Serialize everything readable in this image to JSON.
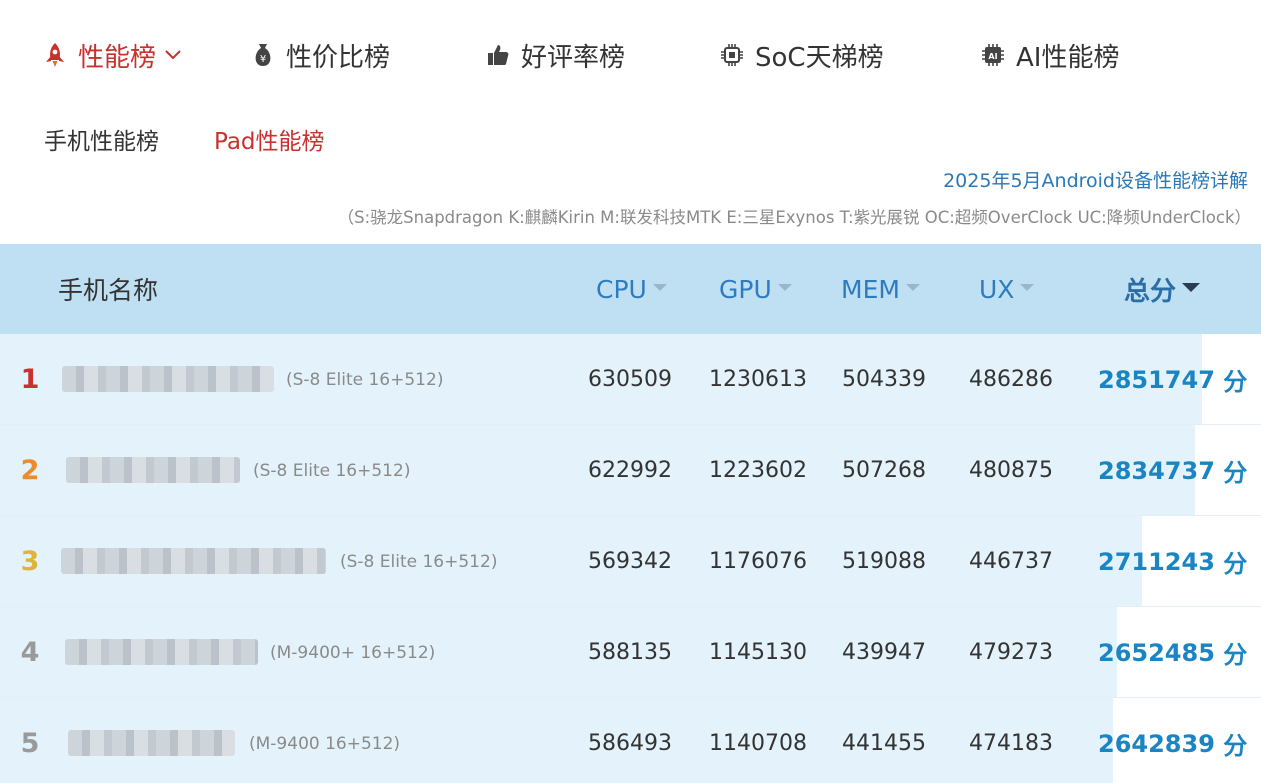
{
  "colors": {
    "accent_red": "#c8312e",
    "link_blue": "#2a78b8",
    "header_bg": "#bfe0f3",
    "row_bar": "#e4f3fb",
    "score_blue": "#1a85c2"
  },
  "nav": {
    "items": [
      {
        "label": "性能榜",
        "icon": "rocket-icon",
        "active": true
      },
      {
        "label": "性价比榜",
        "icon": "money-bag-icon",
        "active": false
      },
      {
        "label": "好评率榜",
        "icon": "thumbs-up-icon",
        "active": false
      },
      {
        "label": "SoC天梯榜",
        "icon": "chip-icon",
        "active": false
      },
      {
        "label": "AI性能榜",
        "icon": "ai-chip-icon",
        "active": false
      }
    ]
  },
  "subnav": {
    "items": [
      {
        "label": "手机性能榜",
        "active": false
      },
      {
        "label": "Pad性能榜",
        "active": true
      }
    ]
  },
  "detail_link": "2025年5月Android设备性能榜详解",
  "legend_note": "（S:骁龙Snapdragon K:麒麟Kirin M:联发科技MTK E:三星Exynos T:紫光展锐 OC:超频OverClock UC:降频UnderClock）",
  "table": {
    "headers": {
      "name": "手机名称",
      "cpu": "CPU",
      "gpu": "GPU",
      "mem": "MEM",
      "ux": "UX",
      "total": "总分"
    },
    "score_unit": "分",
    "rows": [
      {
        "rank": "1",
        "spec": "(S-8 Elite 16+512)",
        "cpu": "630509",
        "gpu": "1230613",
        "mem": "504339",
        "ux": "486286",
        "total": "2851747",
        "rank_color": "#c8312e",
        "fill": 1.0
      },
      {
        "rank": "2",
        "spec": "(S-8 Elite 16+512)",
        "cpu": "622992",
        "gpu": "1223602",
        "mem": "507268",
        "ux": "480875",
        "total": "2834737",
        "rank_color": "#ef8a2c",
        "fill": 0.994
      },
      {
        "rank": "3",
        "spec": "(S-8 Elite 16+512)",
        "cpu": "569342",
        "gpu": "1176076",
        "mem": "519088",
        "ux": "446737",
        "total": "2711243",
        "rank_color": "#e0b43a",
        "fill": 0.951
      },
      {
        "rank": "4",
        "spec": "(M-9400+ 16+512)",
        "cpu": "588135",
        "gpu": "1145130",
        "mem": "439947",
        "ux": "479273",
        "total": "2652485",
        "rank_color": "#9a9a9a",
        "fill": 0.93
      },
      {
        "rank": "5",
        "spec": "(M-9400 16+512)",
        "cpu": "586493",
        "gpu": "1140708",
        "mem": "441455",
        "ux": "474183",
        "total": "2642839",
        "rank_color": "#9a9a9a",
        "fill": 0.927
      }
    ]
  }
}
